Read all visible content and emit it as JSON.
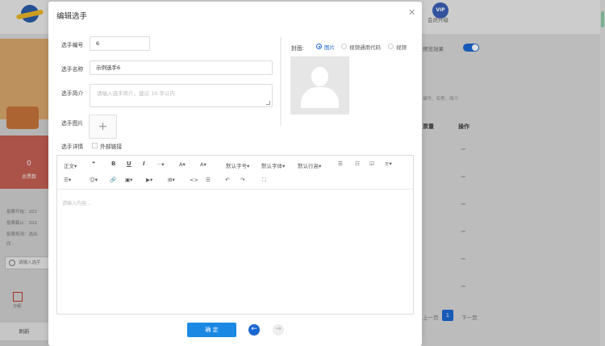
{
  "background": {
    "vip_badge": "VIP",
    "vip_label": "会员升级",
    "stat_value": "0",
    "stat_label": "总票数",
    "info_lines": [
      "投票开始：202",
      "投票截止：202",
      "投票规则：选出",
      "                    同 -"
    ],
    "search_placeholder": "请输入选手",
    "tab_label": "分组",
    "bottom_btn": "刷新",
    "preview_label": "预览效果",
    "filter_hint": "编号、名称、简介",
    "columns": [
      "票量",
      "操作"
    ],
    "row_actions": [
      "···",
      "···",
      "···",
      "···",
      "···",
      "···"
    ],
    "pagination": {
      "prev": "上一页",
      "current": "1",
      "next": "下一页"
    }
  },
  "modal": {
    "title": "编辑选手",
    "close_icon": "close-icon",
    "fields": {
      "number_label": "选手编号",
      "number_value": "6",
      "name_label": "选手名称",
      "name_value": "示例选手6",
      "intro_label": "选手简介",
      "intro_placeholder": "请输入选手简介，建议 10 字以内",
      "image_label": "选手图片",
      "upload_plus": "+",
      "detail_label": "选手详情",
      "external_link_label": "外部链接"
    },
    "cover": {
      "label": "封面:",
      "options": [
        {
          "label": "图片",
          "selected": true
        },
        {
          "label": "视频通用代码",
          "selected": false
        },
        {
          "label": "视频",
          "selected": false
        }
      ]
    },
    "toolbar": {
      "row1": [
        "正文▾",
        "❝",
        "B",
        "U",
        "I",
        "···▾",
        "A▾",
        "A▾",
        "默认字号▾",
        "默认字体▾",
        "默认行高▾",
        "☰",
        "☷",
        "☑",
        "≡▾"
      ],
      "row2": [
        "☰▾",
        "☺▾",
        "🔗",
        "▣▾",
        "▶▾",
        "⊞▾",
        "<>",
        "☰",
        "↶",
        "↷",
        "⛶"
      ]
    },
    "editor_placeholder": "请输入内容...",
    "confirm_label": "确 定",
    "prev_icon": "arrow-left-icon",
    "next_icon": "arrow-right-icon"
  },
  "colors": {
    "accent": "#1b67d2",
    "confirm": "#1b88e4"
  }
}
